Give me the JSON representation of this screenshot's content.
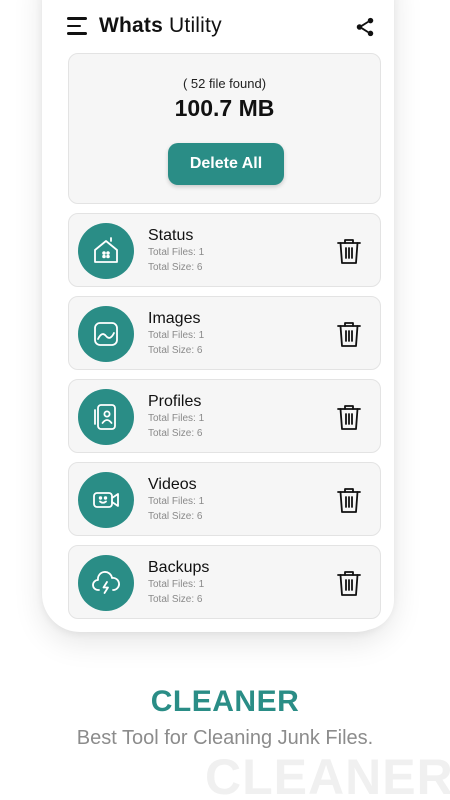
{
  "app": {
    "title_bold": "Whats",
    "title_regular": "Utility",
    "accent_color": "#2a8d86"
  },
  "summary": {
    "found_text": "( 52 file found)",
    "total_size": "100.7 MB",
    "delete_all_label": "Delete All"
  },
  "items": [
    {
      "name": "Status",
      "files": "Total Files: 1",
      "size": "Total Size: 6",
      "icon": "status-home-icon"
    },
    {
      "name": "Images",
      "files": "Total Files: 1",
      "size": "Total Size: 6",
      "icon": "image-icon"
    },
    {
      "name": "Profiles",
      "files": "Total Files: 1",
      "size": "Total Size: 6",
      "icon": "profile-icon"
    },
    {
      "name": "Videos",
      "files": "Total Files: 1",
      "size": "Total Size: 6",
      "icon": "video-icon"
    },
    {
      "name": "Backups",
      "files": "Total Files: 1",
      "size": "Total Size: 6",
      "icon": "cloud-backup-icon"
    }
  ],
  "caption": {
    "title": "CLEANER",
    "subtitle": "Best Tool for Cleaning Junk Files.",
    "watermark": "CLEANER"
  }
}
